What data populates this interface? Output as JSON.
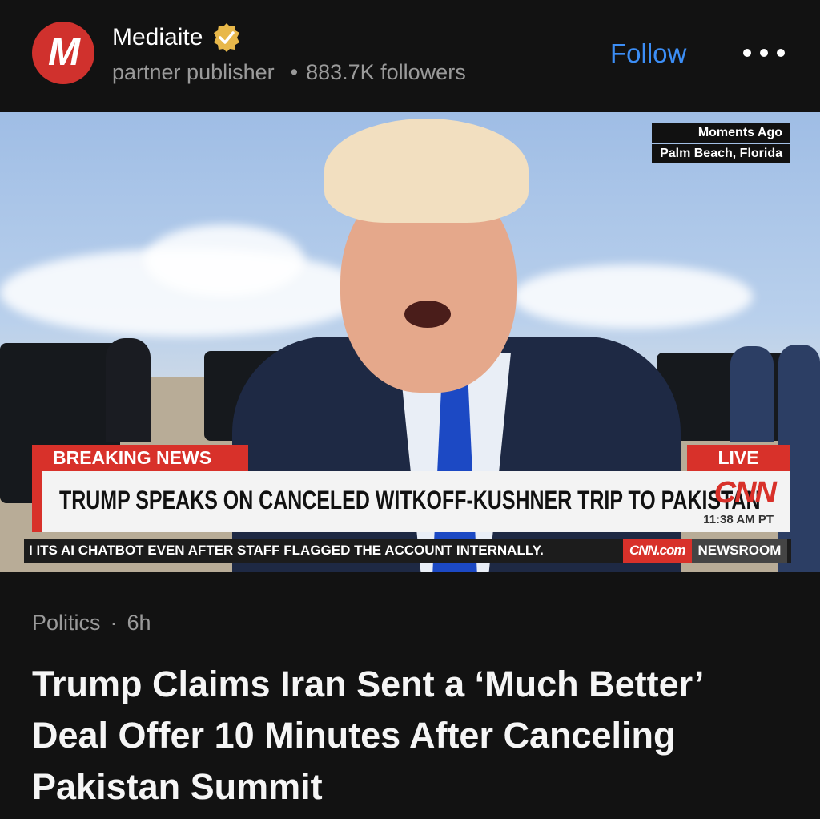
{
  "publisher": {
    "name": "Mediaite",
    "logo_letter": "M",
    "type": "partner publisher",
    "followers": "883.7K followers",
    "follow_label": "Follow",
    "verified_color": "#e8b84a",
    "logo_color": "#d0312d"
  },
  "broadcast": {
    "time_label": "Moments Ago",
    "location": "Palm Beach, Florida",
    "breaking_label": "BREAKING NEWS",
    "live_label": "LIVE",
    "headline": "TRUMP SPEAKS ON CANCELED WITKOFF-KUSHNER TRIP TO PAKISTAN",
    "network": "CNN",
    "clock": "11:38 AM PT",
    "ticker": "I ITS AI CHATBOT EVEN AFTER STAFF FLAGGED THE ACCOUNT INTERNALLY.",
    "ticker_brand": "CNN.com",
    "ticker_label": "NEWSROOM"
  },
  "article": {
    "category": "Politics",
    "age": "6h",
    "title": "Trump Claims Iran Sent a ‘Much Better’ Deal Offer 10 Minutes After Canceling Pakistan Summit"
  }
}
